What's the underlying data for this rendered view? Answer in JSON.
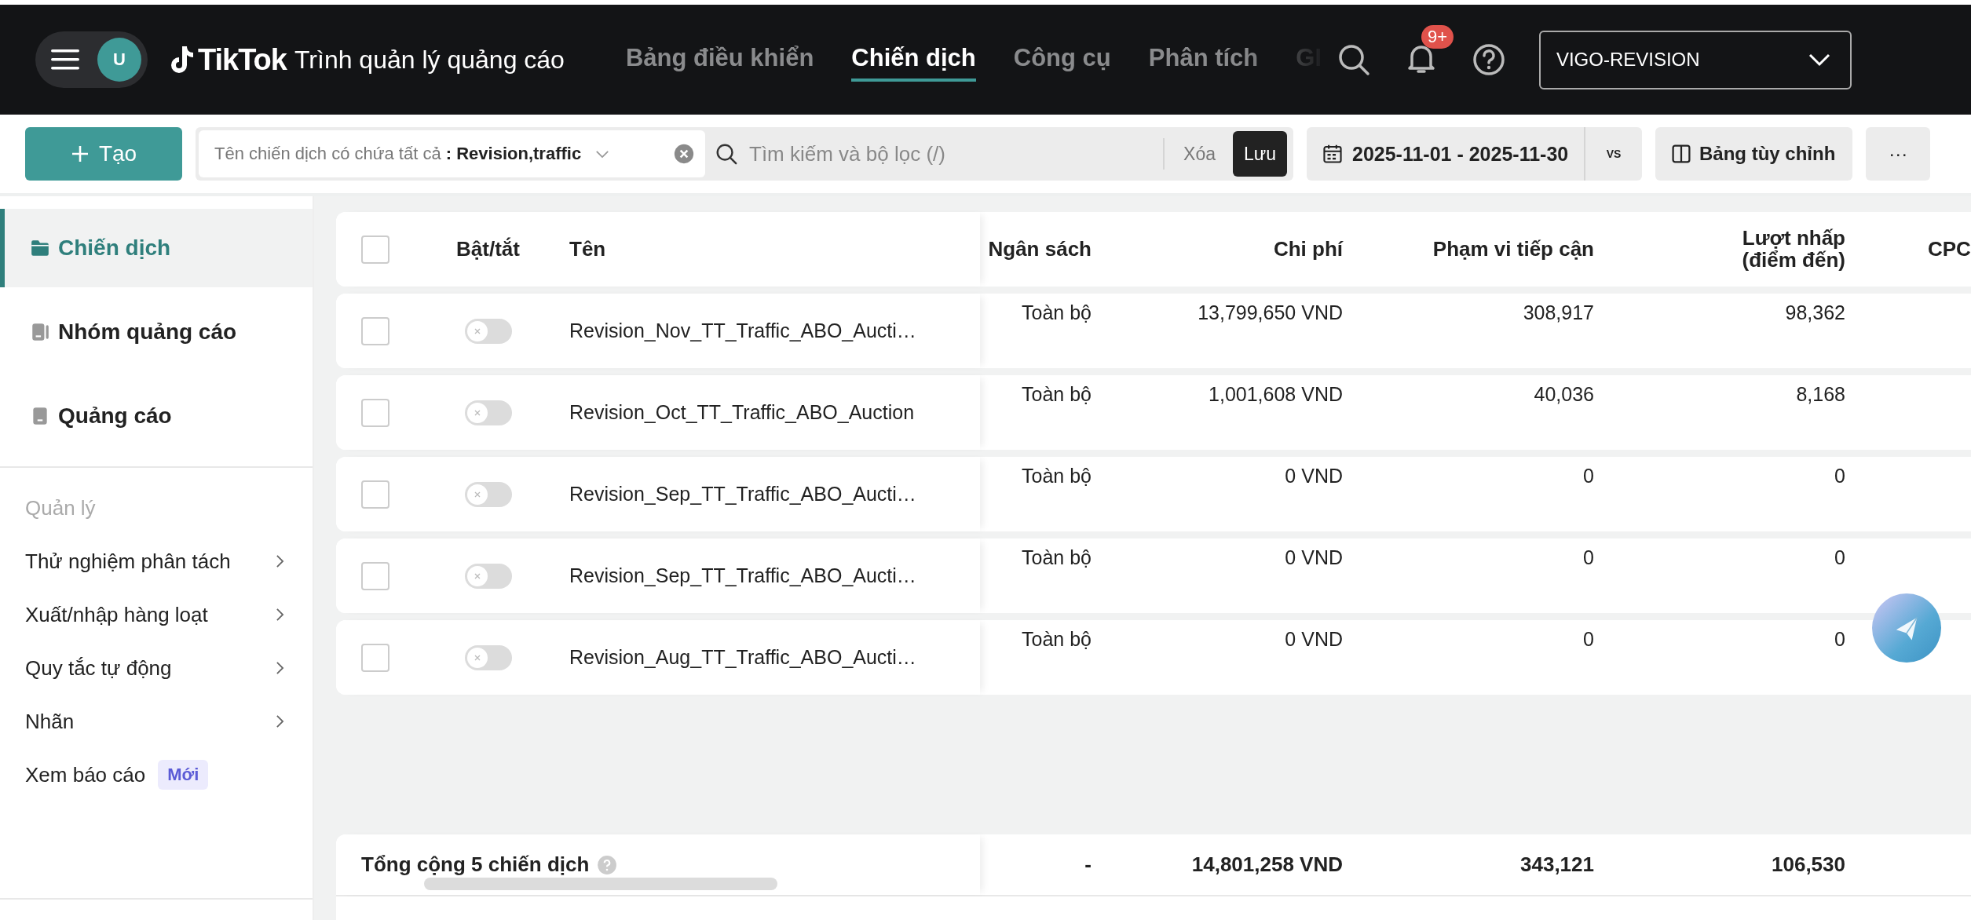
{
  "header": {
    "avatar": "U",
    "logo": "TikTok",
    "product": "Trình quản lý quảng cáo",
    "nav": [
      {
        "label": "Bảng điều khiển",
        "selected": false
      },
      {
        "label": "Chiến dịch",
        "selected": true
      },
      {
        "label": "Công cụ",
        "selected": false
      },
      {
        "label": "Phân tích",
        "selected": false
      },
      {
        "label": "GI",
        "selected": false
      }
    ],
    "notifications_badge": "9+",
    "account": "VIGO-REVISION"
  },
  "toolbar": {
    "create": "Tạo",
    "filter": {
      "label": "Tên chiến dịch có chứa tất cả",
      "value": ": Revision,traffic"
    },
    "search": {
      "placeholder": "Tìm kiếm và bộ lọc (/)"
    },
    "clear": "Xóa",
    "save": "Lưu",
    "date_range": "2025-11-01 - 2025-11-30",
    "compare": "VS",
    "custom_columns": "Bảng tùy chỉnh",
    "more": "···"
  },
  "sidebar": {
    "levels": [
      {
        "label": "Chiến dịch",
        "kind": "campaign",
        "selected": true
      },
      {
        "label": "Nhóm quảng cáo",
        "kind": "ad_group",
        "selected": false
      },
      {
        "label": "Quảng cáo",
        "kind": "ad",
        "selected": false
      }
    ],
    "section": "Quản lý",
    "items": [
      {
        "label": "Thử nghiệm phân tách",
        "kind": "submenu"
      },
      {
        "label": "Xuất/nhập hàng loạt",
        "kind": "submenu"
      },
      {
        "label": "Quy tắc tự động",
        "kind": "submenu"
      },
      {
        "label": "Nhãn",
        "kind": "submenu"
      },
      {
        "label": "Xem báo cáo",
        "kind": "badge",
        "badge": "Mới"
      }
    ]
  },
  "table": {
    "all_checked": false,
    "columns": [
      "Bật/tắt",
      "Tên",
      "Ngân sách",
      "Chi phí",
      "Phạm vi tiếp cận",
      "Lượt nhấp (điểm đến)",
      "CPC"
    ],
    "rows": [
      {
        "checked": false,
        "on": false,
        "name": "Revision_Nov_TT_Traffic_ABO_Aucti…",
        "budget": "Toàn bộ",
        "cost": "13,799,650 VND",
        "reach": "308,917",
        "clicks": "98,362"
      },
      {
        "checked": false,
        "on": false,
        "name": "Revision_Oct_TT_Traffic_ABO_Auction",
        "budget": "Toàn bộ",
        "cost": "1,001,608 VND",
        "reach": "40,036",
        "clicks": "8,168"
      },
      {
        "checked": false,
        "on": false,
        "name": "Revision_Sep_TT_Traffic_ABO_Aucti…",
        "budget": "Toàn bộ",
        "cost": "0 VND",
        "reach": "0",
        "clicks": "0"
      },
      {
        "checked": false,
        "on": false,
        "name": "Revision_Sep_TT_Traffic_ABO_Aucti…",
        "budget": "Toàn bộ",
        "cost": "0 VND",
        "reach": "0",
        "clicks": "0"
      },
      {
        "checked": false,
        "on": false,
        "name": "Revision_Aug_TT_Traffic_ABO_Aucti…",
        "budget": "Toàn bộ",
        "cost": "0 VND",
        "reach": "0",
        "clicks": "0"
      }
    ],
    "total": {
      "label": "Tổng cộng 5 chiến dịch",
      "budget": "-",
      "cost": "14,801,258 VND",
      "reach": "343,121",
      "clicks": "106,530"
    }
  }
}
